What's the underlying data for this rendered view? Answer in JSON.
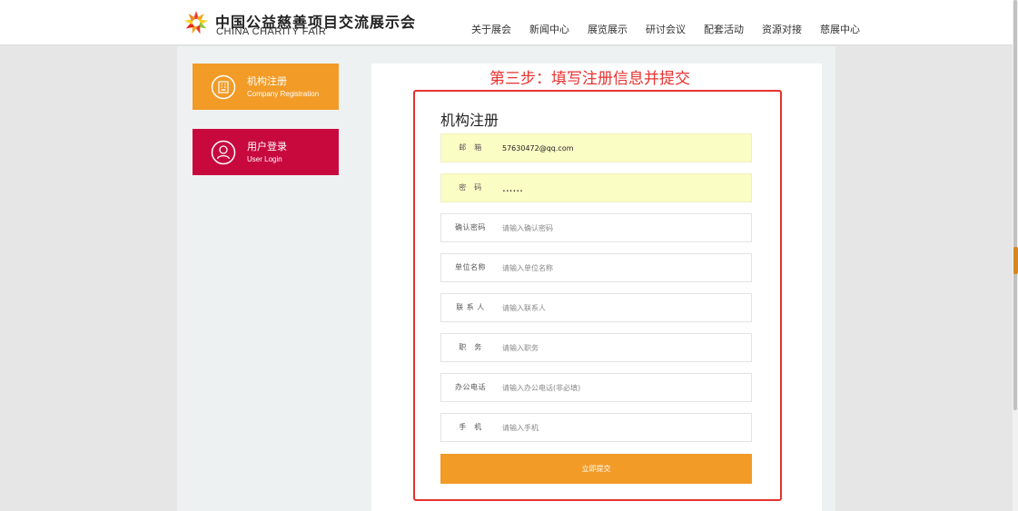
{
  "header": {
    "brand_cn": "中国公益慈善项目交流展示会",
    "brand_en": "CHINA CHARITY FAIR",
    "nav": [
      "关于展会",
      "新闻中心",
      "展览展示",
      "研讨会议",
      "配套活动",
      "资源对接",
      "慈展中心"
    ]
  },
  "sidebar": {
    "items": [
      {
        "title": "机构注册",
        "subtitle": "Company Registration",
        "color": "#f29b27"
      },
      {
        "title": "用户登录",
        "subtitle": "User Login",
        "color": "#c8093e"
      }
    ]
  },
  "main": {
    "step_banner": "第三步：填写注册信息并提交",
    "form_title": "机构注册",
    "fields": [
      {
        "label": "邮　箱",
        "value": "57630472@qq.com",
        "placeholder": ""
      },
      {
        "label": "密　码",
        "value": "......",
        "placeholder": ""
      },
      {
        "label": "确认密码",
        "value": "",
        "placeholder": "请输入确认密码"
      },
      {
        "label": "单位名称",
        "value": "",
        "placeholder": "请输入单位名称"
      },
      {
        "label": "联 系 人",
        "value": "",
        "placeholder": "请输入联系人"
      },
      {
        "label": "职　务",
        "value": "",
        "placeholder": "请输入职务"
      },
      {
        "label": "办公电话",
        "value": "",
        "placeholder": "请输入办公电话(非必填)"
      },
      {
        "label": "手　机",
        "value": "",
        "placeholder": "请输入手机"
      }
    ],
    "submit_label": "立即提交"
  },
  "colors": {
    "accent_orange": "#f29b27",
    "accent_red": "#c8093e",
    "highlight_red": "#e6322e",
    "autofill_yellow": "#fafdc4"
  }
}
